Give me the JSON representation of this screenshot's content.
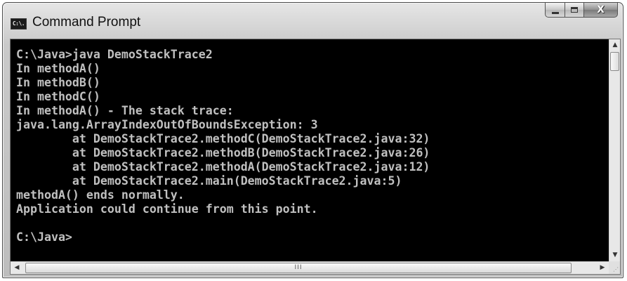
{
  "window": {
    "title": "Command Prompt",
    "icon": "console-app-icon",
    "icon_label": "C:\\.",
    "controls": {
      "minimize_icon": "minimize-icon",
      "maximize_icon": "maximize-icon",
      "close_icon": "close-icon",
      "close_glyph": "X"
    }
  },
  "console": {
    "text_color": "#c0c0c0",
    "background_color": "#000000",
    "lines": [
      "C:\\Java>java DemoStackTrace2",
      "In methodA()",
      "In methodB()",
      "In methodC()",
      "In methodA() - The stack trace:",
      "java.lang.ArrayIndexOutOfBoundsException: 3",
      "        at DemoStackTrace2.methodC(DemoStackTrace2.java:32)",
      "        at DemoStackTrace2.methodB(DemoStackTrace2.java:26)",
      "        at DemoStackTrace2.methodA(DemoStackTrace2.java:12)",
      "        at DemoStackTrace2.main(DemoStackTrace2.java:5)",
      "methodA() ends normally.",
      "Application could continue from this point.",
      "",
      "C:\\Java>"
    ]
  },
  "scrollbars": {
    "up_arrow": "▲",
    "down_arrow": "▼",
    "left_arrow": "◀",
    "right_arrow": "▶",
    "thumb_grip": "III",
    "resize_grip": "⋰"
  }
}
